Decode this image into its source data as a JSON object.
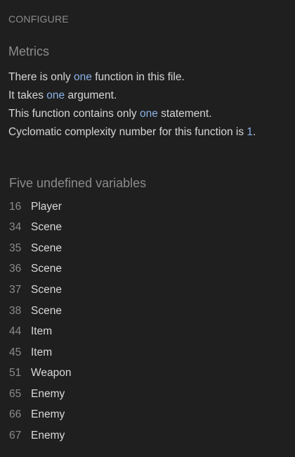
{
  "header": {
    "configure_label": "CONFIGURE"
  },
  "metrics": {
    "title": "Metrics",
    "lines": [
      {
        "pre": "There is only ",
        "hl": "one",
        "post": " function in this file."
      },
      {
        "pre": "It takes ",
        "hl": "one",
        "post": " argument."
      },
      {
        "pre": "This function contains only ",
        "hl": "one",
        "post": " statement."
      },
      {
        "pre": "Cyclomatic complexity number for this function is ",
        "hl": "1",
        "post": "."
      }
    ]
  },
  "undefined_variables": {
    "title": "Five undefined variables",
    "items": [
      {
        "line": "16",
        "name": "Player"
      },
      {
        "line": "34",
        "name": "Scene"
      },
      {
        "line": "35",
        "name": "Scene"
      },
      {
        "line": "36",
        "name": "Scene"
      },
      {
        "line": "37",
        "name": "Scene"
      },
      {
        "line": "38",
        "name": "Scene"
      },
      {
        "line": "44",
        "name": "Item"
      },
      {
        "line": "45",
        "name": "Item"
      },
      {
        "line": "51",
        "name": "Weapon"
      },
      {
        "line": "65",
        "name": "Enemy"
      },
      {
        "line": "66",
        "name": "Enemy"
      },
      {
        "line": "67",
        "name": "Enemy"
      }
    ]
  },
  "colors": {
    "background": "#1f1f1f",
    "highlight": "#8ab1e6",
    "text": "#d6d6d6",
    "muted": "#8a8a8a"
  }
}
